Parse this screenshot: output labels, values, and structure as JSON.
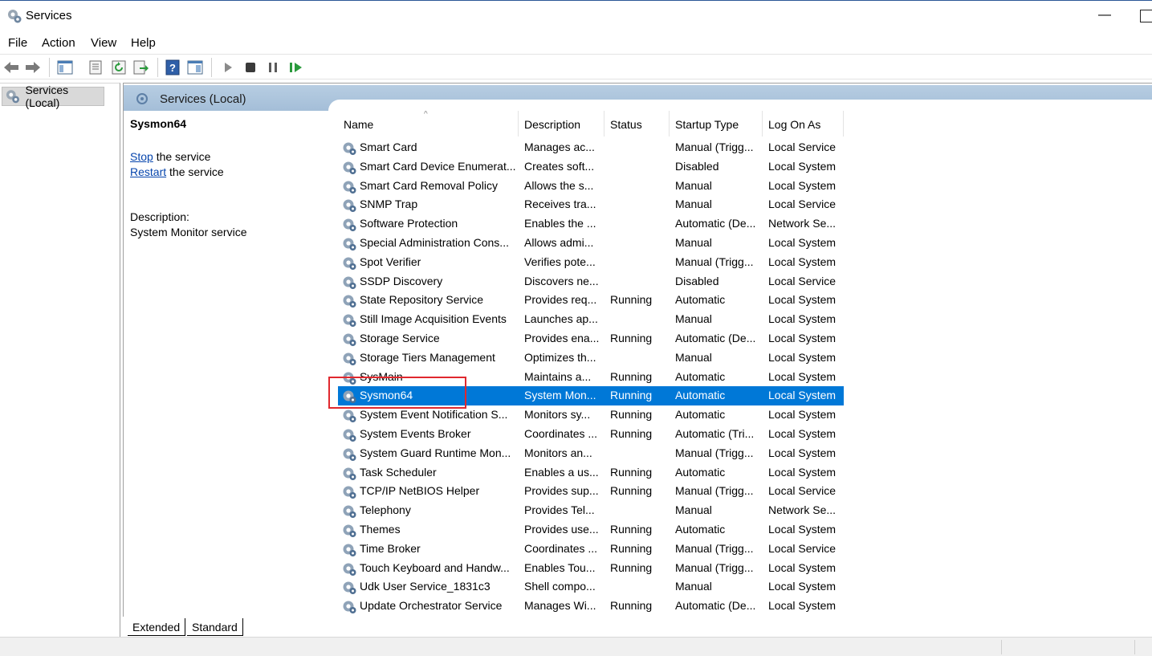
{
  "window": {
    "title": "Services",
    "minimize_glyph": "—"
  },
  "menu": [
    "File",
    "Action",
    "View",
    "Help"
  ],
  "toolbar_icons": [
    "back-arrow-icon",
    "forward-arrow-icon",
    "show-hide-tree-icon",
    "properties-icon",
    "refresh-icon",
    "export-list-icon",
    "help-icon",
    "show-console-icon",
    "start-service-icon",
    "stop-service-icon",
    "pause-service-icon",
    "restart-service-icon"
  ],
  "tree": {
    "root_label": "Services (Local)"
  },
  "content_header": {
    "title": "Services (Local)"
  },
  "details": {
    "service_name": "Sysmon64",
    "stop_link": "Stop",
    "stop_suffix": " the service",
    "restart_link": "Restart",
    "restart_suffix": " the service",
    "description_label": "Description:",
    "description_text": "System Monitor service"
  },
  "columns": [
    "Name",
    "Description",
    "Status",
    "Startup Type",
    "Log On As"
  ],
  "services": [
    {
      "name": "Smart Card",
      "description": "Manages ac...",
      "status": "",
      "startup": "Manual (Trigg...",
      "logon": "Local Service"
    },
    {
      "name": "Smart Card Device Enumerat...",
      "description": "Creates soft...",
      "status": "",
      "startup": "Disabled",
      "logon": "Local System"
    },
    {
      "name": "Smart Card Removal Policy",
      "description": "Allows the s...",
      "status": "",
      "startup": "Manual",
      "logon": "Local System"
    },
    {
      "name": "SNMP Trap",
      "description": "Receives tra...",
      "status": "",
      "startup": "Manual",
      "logon": "Local Service"
    },
    {
      "name": "Software Protection",
      "description": "Enables the ...",
      "status": "",
      "startup": "Automatic (De...",
      "logon": "Network Se..."
    },
    {
      "name": "Special Administration Cons...",
      "description": "Allows admi...",
      "status": "",
      "startup": "Manual",
      "logon": "Local System"
    },
    {
      "name": "Spot Verifier",
      "description": "Verifies pote...",
      "status": "",
      "startup": "Manual (Trigg...",
      "logon": "Local System"
    },
    {
      "name": "SSDP Discovery",
      "description": "Discovers ne...",
      "status": "",
      "startup": "Disabled",
      "logon": "Local Service"
    },
    {
      "name": "State Repository Service",
      "description": "Provides req...",
      "status": "Running",
      "startup": "Automatic",
      "logon": "Local System"
    },
    {
      "name": "Still Image Acquisition Events",
      "description": "Launches ap...",
      "status": "",
      "startup": "Manual",
      "logon": "Local System"
    },
    {
      "name": "Storage Service",
      "description": "Provides ena...",
      "status": "Running",
      "startup": "Automatic (De...",
      "logon": "Local System"
    },
    {
      "name": "Storage Tiers Management",
      "description": "Optimizes th...",
      "status": "",
      "startup": "Manual",
      "logon": "Local System"
    },
    {
      "name": "SysMain",
      "description": "Maintains a...",
      "status": "Running",
      "startup": "Automatic",
      "logon": "Local System"
    },
    {
      "name": "Sysmon64",
      "description": "System Mon...",
      "status": "Running",
      "startup": "Automatic",
      "logon": "Local System",
      "selected": true
    },
    {
      "name": "System Event Notification S...",
      "description": "Monitors sy...",
      "status": "Running",
      "startup": "Automatic",
      "logon": "Local System"
    },
    {
      "name": "System Events Broker",
      "description": "Coordinates ...",
      "status": "Running",
      "startup": "Automatic (Tri...",
      "logon": "Local System"
    },
    {
      "name": "System Guard Runtime Mon...",
      "description": "Monitors an...",
      "status": "",
      "startup": "Manual (Trigg...",
      "logon": "Local System"
    },
    {
      "name": "Task Scheduler",
      "description": "Enables a us...",
      "status": "Running",
      "startup": "Automatic",
      "logon": "Local System"
    },
    {
      "name": "TCP/IP NetBIOS Helper",
      "description": "Provides sup...",
      "status": "Running",
      "startup": "Manual (Trigg...",
      "logon": "Local Service"
    },
    {
      "name": "Telephony",
      "description": "Provides Tel...",
      "status": "",
      "startup": "Manual",
      "logon": "Network Se..."
    },
    {
      "name": "Themes",
      "description": "Provides use...",
      "status": "Running",
      "startup": "Automatic",
      "logon": "Local System"
    },
    {
      "name": "Time Broker",
      "description": "Coordinates ...",
      "status": "Running",
      "startup": "Manual (Trigg...",
      "logon": "Local Service"
    },
    {
      "name": "Touch Keyboard and Handw...",
      "description": "Enables Tou...",
      "status": "Running",
      "startup": "Manual (Trigg...",
      "logon": "Local System"
    },
    {
      "name": "Udk User Service_1831c3",
      "description": "Shell compo...",
      "status": "",
      "startup": "Manual",
      "logon": "Local System"
    },
    {
      "name": "Update Orchestrator Service",
      "description": "Manages Wi...",
      "status": "Running",
      "startup": "Automatic (De...",
      "logon": "Local System"
    }
  ],
  "bottom_tabs": [
    "Extended",
    "Standard"
  ],
  "colors": {
    "selection": "#0078d7",
    "header_band": "#b7cde2",
    "highlight": "#e0282e"
  }
}
